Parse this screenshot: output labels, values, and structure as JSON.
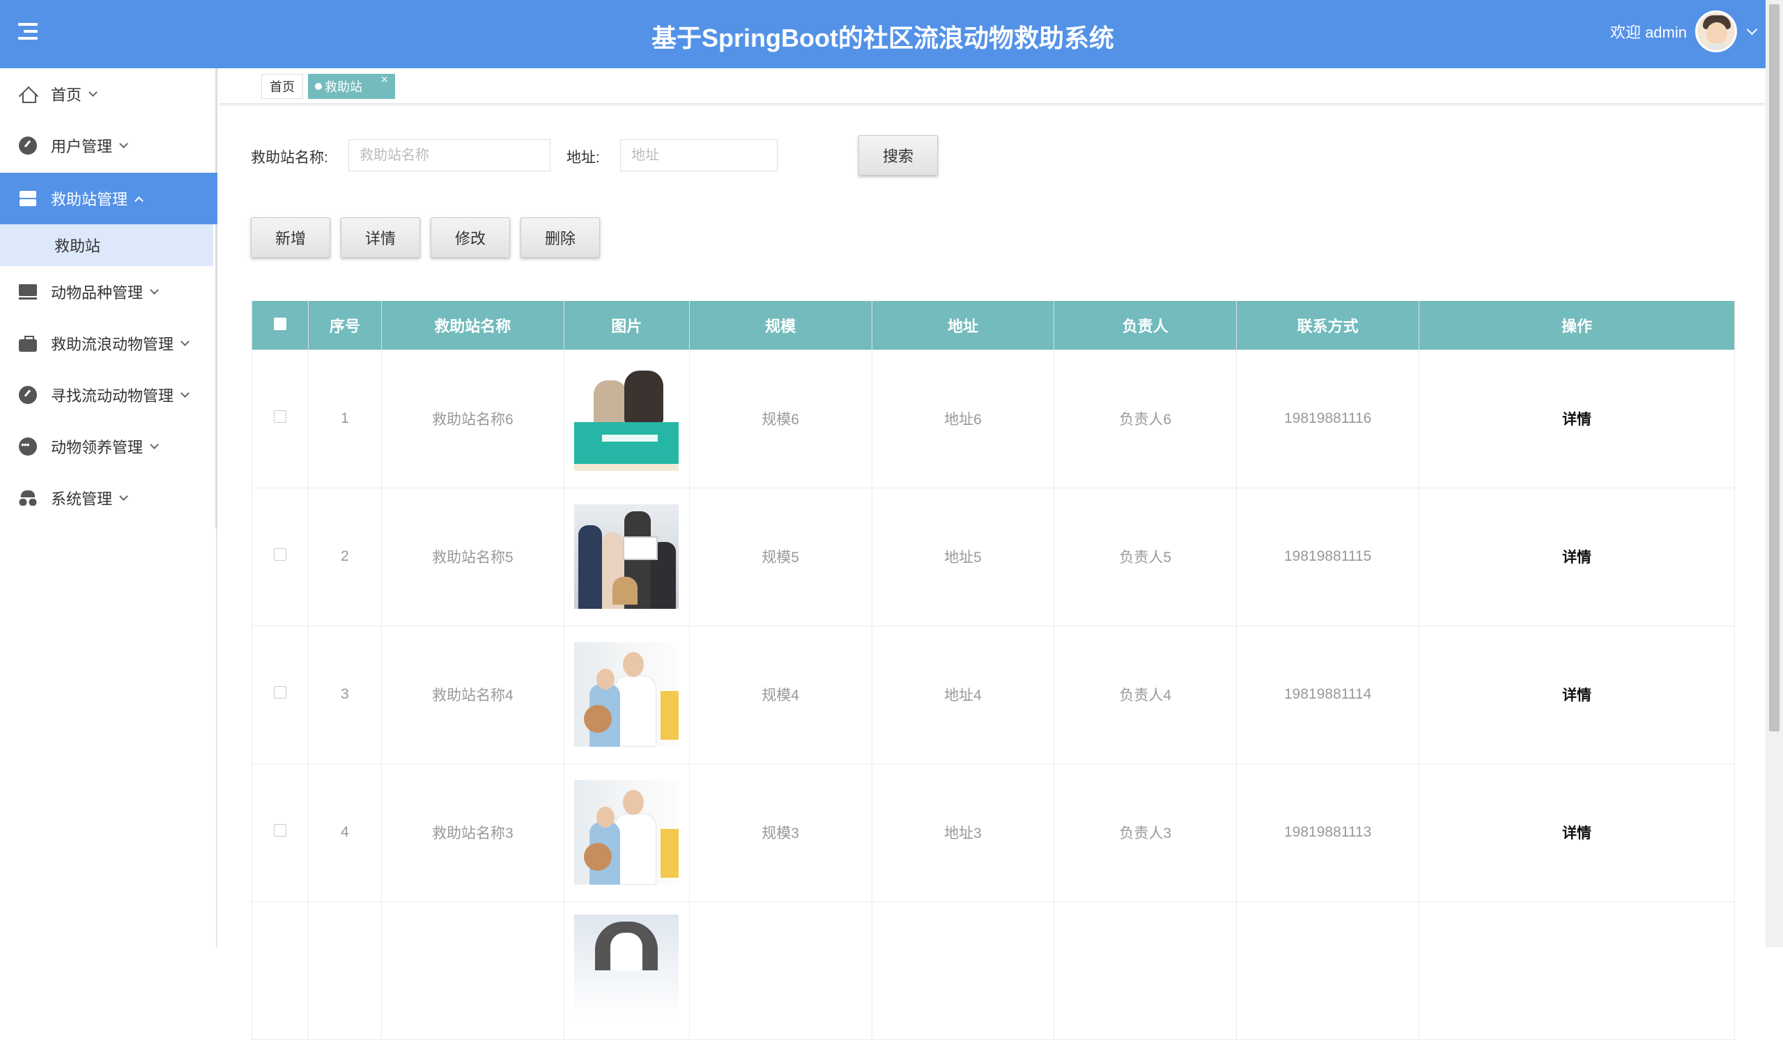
{
  "header": {
    "title": "基于SpringBoot的社区流浪动物救助系统",
    "welcome": "欢迎 admin"
  },
  "sidebar": {
    "items": [
      {
        "label": "首页",
        "icon": "home-icon"
      },
      {
        "label": "用户管理",
        "icon": "gauge-icon"
      },
      {
        "label": "救助站管理",
        "icon": "server-icon",
        "active": true
      },
      {
        "label": "动物品种管理",
        "icon": "monitor-icon"
      },
      {
        "label": "救助流浪动物管理",
        "icon": "briefcase-icon"
      },
      {
        "label": "寻找流动动物管理",
        "icon": "gauge-icon"
      },
      {
        "label": "动物领养管理",
        "icon": "dots-icon"
      },
      {
        "label": "系统管理",
        "icon": "spy-icon"
      }
    ],
    "submenu": {
      "label": "救助站"
    }
  },
  "tabs": {
    "home": "首页",
    "active": "救助站",
    "close": "×"
  },
  "search": {
    "name_label": "救助站名称:",
    "name_placeholder": "救助站名称",
    "address_label": "地址:",
    "address_placeholder": "地址",
    "search_button": "搜索"
  },
  "actions": {
    "add": "新增",
    "detail": "详情",
    "edit": "修改",
    "delete": "删除"
  },
  "table": {
    "headers": [
      "序号",
      "救助站名称",
      "图片",
      "规模",
      "地址",
      "负责人",
      "联系方式",
      "操作"
    ],
    "rows": [
      {
        "index": "1",
        "name": "救助站名称6",
        "scale": "规模6",
        "address": "地址6",
        "manager": "负责人6",
        "phone": "19819881116",
        "action": "详情"
      },
      {
        "index": "2",
        "name": "救助站名称5",
        "scale": "规模5",
        "address": "地址5",
        "manager": "负责人5",
        "phone": "19819881115",
        "action": "详情"
      },
      {
        "index": "3",
        "name": "救助站名称4",
        "scale": "规模4",
        "address": "地址4",
        "manager": "负责人4",
        "phone": "19819881114",
        "action": "详情"
      },
      {
        "index": "4",
        "name": "救助站名称3",
        "scale": "规模3",
        "address": "地址3",
        "manager": "负责人3",
        "phone": "19819881113",
        "action": "详情"
      }
    ]
  },
  "colors": {
    "header": "#5492e8",
    "table_header": "#73bbbd",
    "active_submenu": "#dde9fb"
  }
}
